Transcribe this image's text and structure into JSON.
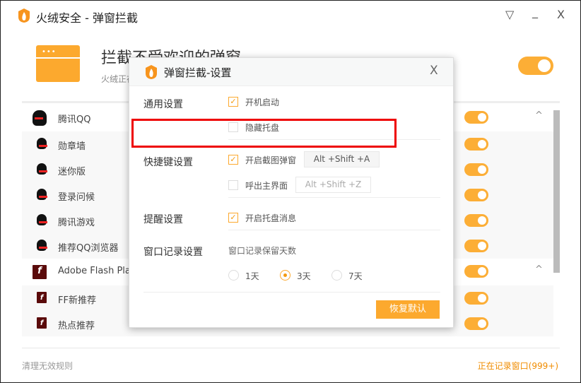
{
  "window": {
    "title": "火绒安全 - 弹窗拦截",
    "menu_icon": "▽",
    "min_icon": "_",
    "close_icon": "X"
  },
  "header": {
    "title": "拦截不受欢迎的弹窗",
    "subtitle": "火绒正在",
    "enabled": true
  },
  "list": [
    {
      "label": "腾讯QQ",
      "type": "parent",
      "icon": "qq-penguin",
      "enabled": true,
      "expanded": true
    },
    {
      "label": "勋章墙",
      "type": "sub",
      "icon": "qq-penguin",
      "enabled": true
    },
    {
      "label": "迷你版",
      "type": "sub",
      "icon": "qq-penguin",
      "enabled": true
    },
    {
      "label": "登录问候",
      "type": "sub",
      "icon": "qq-penguin",
      "enabled": true
    },
    {
      "label": "腾讯游戏",
      "type": "sub",
      "icon": "qq-penguin",
      "enabled": true
    },
    {
      "label": "推荐QQ浏览器",
      "type": "sub",
      "icon": "qq-penguin",
      "enabled": true
    },
    {
      "label": "Adobe Flash Play",
      "type": "parent",
      "icon": "flash",
      "enabled": true,
      "expanded": true
    },
    {
      "label": "FF新推荐",
      "type": "sub",
      "icon": "flash",
      "enabled": true
    },
    {
      "label": "热点推荐",
      "type": "sub",
      "icon": "flash",
      "enabled": true
    }
  ],
  "footer": {
    "clean": "清理无效规则",
    "recording": "正在记录窗口(999+)"
  },
  "dialog": {
    "title": "弹窗拦截-设置",
    "close": "X",
    "general": {
      "label": "通用设置",
      "autostart": "开机启动",
      "hide_tray": "隐藏托盘"
    },
    "hotkey": {
      "label": "快捷键设置",
      "screenshot": "开启截图弹窗",
      "screenshot_key": "Alt +Shift +A",
      "main": "呼出主界面",
      "main_key": "Alt +Shift +Z"
    },
    "remind": {
      "label": "提醒设置",
      "tray_msg": "开启托盘消息"
    },
    "record": {
      "label": "窗口记录设置",
      "days_label": "窗口记录保留天数",
      "options": [
        "1天",
        "3天",
        "7天"
      ],
      "selected": "3天"
    },
    "reset": "恢复默认"
  },
  "colors": {
    "accent": "#fca92e",
    "highlight": "#e00000"
  }
}
